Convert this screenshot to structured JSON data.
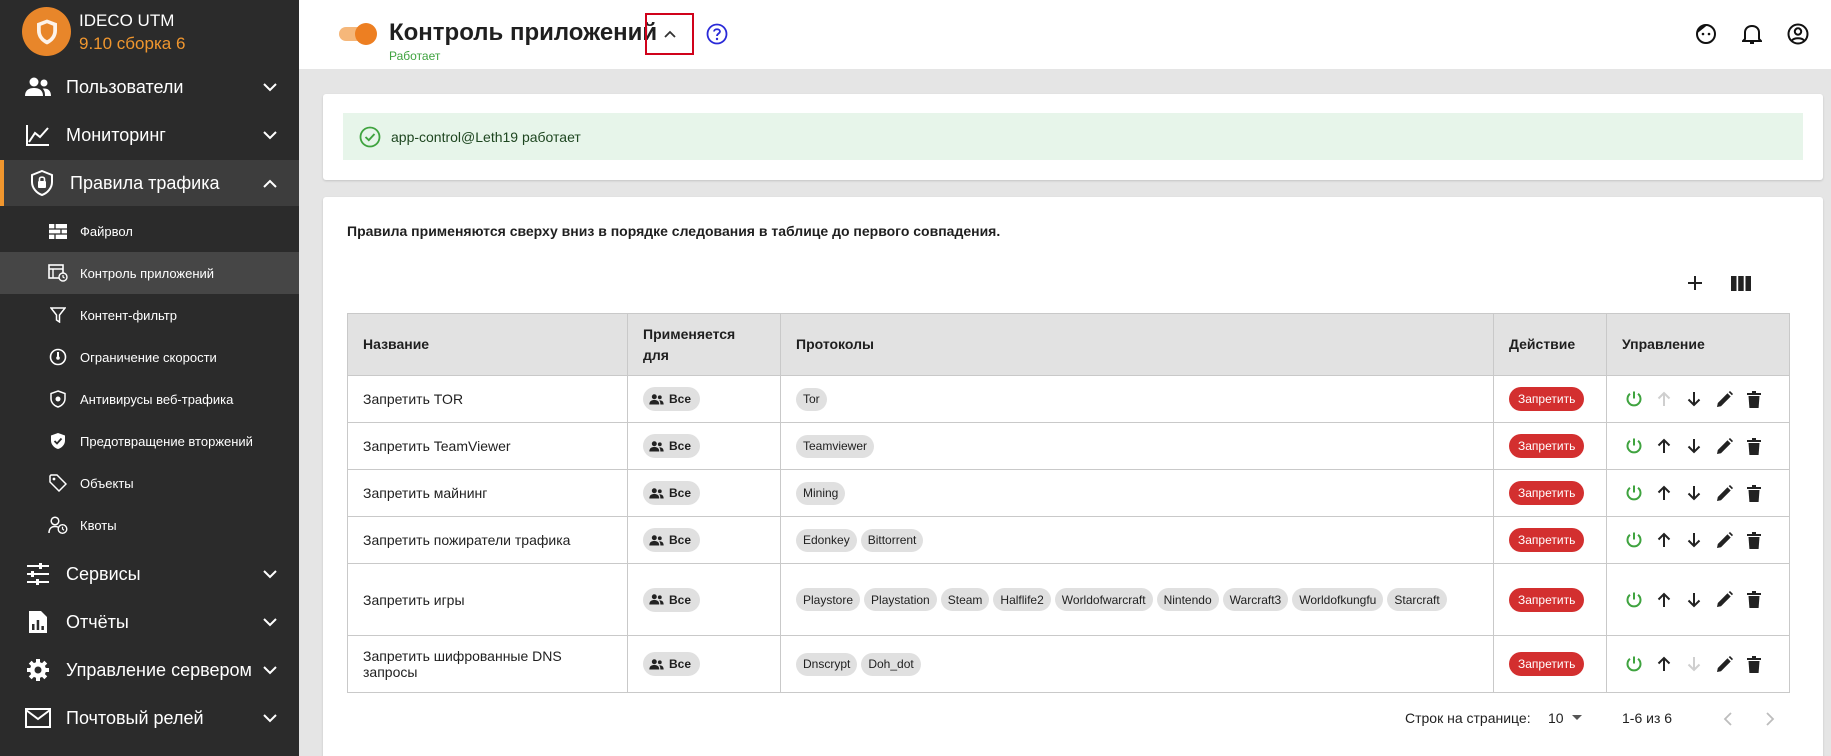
{
  "brand": {
    "name": "IDECO UTM",
    "version": "9.10 сборка 6"
  },
  "sidebar": {
    "items": [
      {
        "label": "Пользователи"
      },
      {
        "label": "Мониторинг"
      },
      {
        "label": "Правила трафика"
      },
      {
        "label": "Сервисы"
      },
      {
        "label": "Отчёты"
      },
      {
        "label": "Управление сервером"
      },
      {
        "label": "Почтовый релей"
      }
    ],
    "subitems": [
      {
        "label": "Файрвол"
      },
      {
        "label": "Контроль приложений"
      },
      {
        "label": "Контент-фильтр"
      },
      {
        "label": "Ограничение скорости"
      },
      {
        "label": "Антивирусы веб-трафика"
      },
      {
        "label": "Предотвращение вторжений"
      },
      {
        "label": "Объекты"
      },
      {
        "label": "Квоты"
      }
    ]
  },
  "header": {
    "title": "Контроль приложений",
    "status": "Работает"
  },
  "alert": {
    "text": "app-control@Leth19 работает"
  },
  "main": {
    "info": "Правила применяются сверху вниз в порядке следования в таблице до первого совпадения.",
    "columns": [
      "Название",
      "Применяется для",
      "Протоколы",
      "Действие",
      "Управление"
    ],
    "rows": [
      {
        "name": "Запретить TOR",
        "applies": "Все",
        "protocols": [
          "Tor"
        ],
        "action": "Запретить"
      },
      {
        "name": "Запретить TeamViewer",
        "applies": "Все",
        "protocols": [
          "Teamviewer"
        ],
        "action": "Запретить"
      },
      {
        "name": "Запретить майнинг",
        "applies": "Все",
        "protocols": [
          "Mining"
        ],
        "action": "Запретить"
      },
      {
        "name": "Запретить пожиратели трафика",
        "applies": "Все",
        "protocols": [
          "Edonkey",
          "Bittorrent"
        ],
        "action": "Запретить"
      },
      {
        "name": "Запретить игры",
        "applies": "Все",
        "protocols": [
          "Playstore",
          "Playstation",
          "Steam",
          "Halflife2",
          "Worldofwarcraft",
          "Nintendo",
          "Warcraft3",
          "Worldofkungfu",
          "Starcraft"
        ],
        "action": "Запретить"
      },
      {
        "name": "Запретить шифрованные DNS запросы",
        "applies": "Все",
        "protocols": [
          "Dnscrypt",
          "Doh_dot"
        ],
        "action": "Запретить"
      }
    ]
  },
  "pager": {
    "rows_per_page_label": "Строк на странице:",
    "rows_per_page": "10",
    "range": "1-6 из 6"
  },
  "colors": {
    "accent": "#ed7f22",
    "sidebar_bg": "#2b2b2b",
    "deny": "#d32f2f",
    "ok": "#3fa33f",
    "alert_bg": "#e7f5ea"
  }
}
